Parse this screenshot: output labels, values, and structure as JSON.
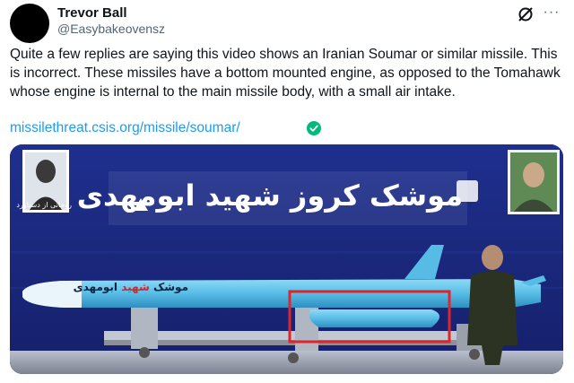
{
  "author": {
    "name": "Trevor Ball",
    "handle": "@Easybakeovensz"
  },
  "tweet": {
    "text": "Quite a few replies are saying this video shows an Iranian Soumar or similar missile. This is incorrect. These missiles have a bottom mounted engine, as opposed to the Tomahawk whose engine is internal to the main missile body, with a small air intake.",
    "link": "missilethreat.csis.org/missile/soumar/"
  },
  "header_icons": [
    "grok-icon",
    "more-options-icon"
  ],
  "media": {
    "banner_text": "موشک کروز شهید ابومهدی",
    "portrait_caption": "روحانی از دستاورد",
    "missile_label_a": "موشک ",
    "missile_label_b": "شهید",
    "missile_label_c": " ابومهدی"
  },
  "colors": {
    "link": "#1d9bf0",
    "verified": "#00ba7c",
    "backdrop": "#1b2b85",
    "missile": "#5ec3ea",
    "highlight_box": "#e0242b"
  }
}
